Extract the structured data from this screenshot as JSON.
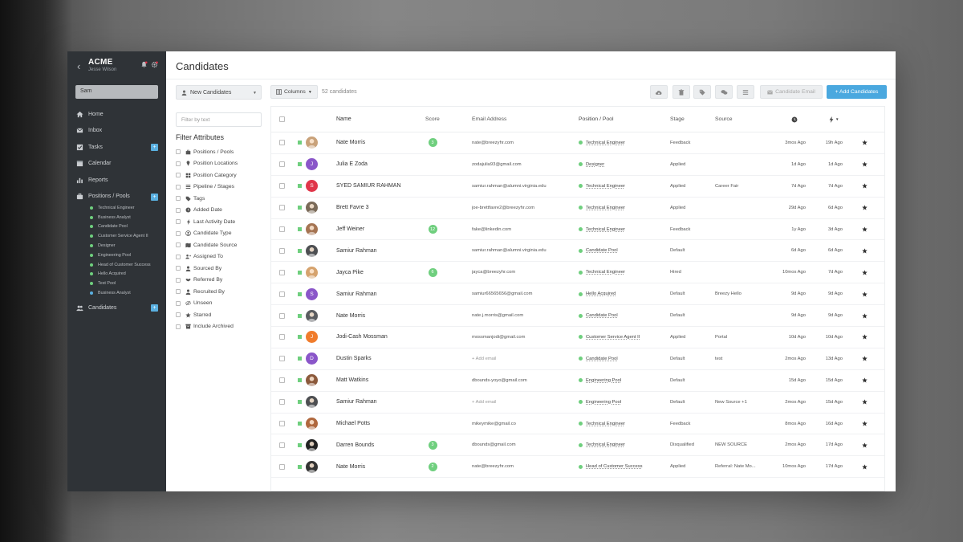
{
  "brand": {
    "name": "ACME",
    "user": "Jesse Wilson"
  },
  "sidebar": {
    "search_value": "Sam",
    "nav": [
      {
        "label": "Home",
        "icon": "home-icon"
      },
      {
        "label": "Inbox",
        "icon": "inbox-icon"
      },
      {
        "label": "Tasks",
        "icon": "tasks-icon",
        "plus": "+"
      },
      {
        "label": "Calendar",
        "icon": "calendar-icon"
      },
      {
        "label": "Reports",
        "icon": "reports-icon"
      },
      {
        "label": "Positions / Pools",
        "icon": "briefcase-icon",
        "plus": "+"
      }
    ],
    "pools": [
      "Technical Engineer",
      "Business Analyst",
      "Candidate Pool",
      "Customer Service Agent II",
      "Designer",
      "Engineering Pool",
      "Head of Customer Success",
      "Hello Acquired",
      "Test Pool",
      "Business Analyst"
    ],
    "candidates": {
      "label": "Candidates",
      "icon": "users-icon",
      "plus": "+"
    }
  },
  "main": {
    "title": "Candidates",
    "pipeline_dropdown": "New Candidates",
    "filter_placeholder": "Filter by text",
    "filter_title": "Filter Attributes",
    "attributes": [
      {
        "label": "Positions / Pools",
        "icon": "briefcase-icon"
      },
      {
        "label": "Position Locations",
        "icon": "pin-icon"
      },
      {
        "label": "Position Category",
        "icon": "grid-icon"
      },
      {
        "label": "Pipeline / Stages",
        "icon": "list-icon"
      },
      {
        "label": "Tags",
        "icon": "tag-icon"
      },
      {
        "label": "Added Date",
        "icon": "clock-icon"
      },
      {
        "label": "Last Activity Date",
        "icon": "bolt-icon"
      },
      {
        "label": "Candidate Type",
        "icon": "user-circle-icon"
      },
      {
        "label": "Candidate Source",
        "icon": "map-icon"
      },
      {
        "label": "Assigned To",
        "icon": "user-plus-icon"
      },
      {
        "label": "Sourced By",
        "icon": "user-icon"
      },
      {
        "label": "Referred By",
        "icon": "handshake-icon"
      },
      {
        "label": "Recruited By",
        "icon": "user-icon"
      },
      {
        "label": "Unseen",
        "icon": "eye-slash-icon"
      },
      {
        "label": "Starred",
        "icon": "star-icon"
      },
      {
        "label": "Include Archived",
        "icon": "archive-icon"
      }
    ],
    "columns_button": "Columns",
    "count": "52 candidates",
    "email_button": "Candidate Email",
    "add_button": "+ Add Candidates",
    "headers": {
      "name": "Name",
      "score": "Score",
      "email": "Email Address",
      "position": "Position / Pool",
      "stage": "Stage",
      "source": "Source"
    },
    "rows": [
      {
        "name": "Nate Morris",
        "score": "3",
        "email": "nate@breezyhr.com",
        "position": "Technical Engineer",
        "stage": "Feedback",
        "source": "",
        "added": "3mos Ago",
        "activity": "19h Ago",
        "avatar": "photo",
        "avatar_color": "#c9a27a"
      },
      {
        "name": "Julia E Zoda",
        "score": "",
        "email": "zodajulia93@gmail.com",
        "position": "Designer",
        "stage": "Applied",
        "source": "",
        "added": "1d Ago",
        "activity": "1d Ago",
        "avatar": "J",
        "avatar_color": "#8a56c9"
      },
      {
        "name": "SYED SAMIUR RAHMAN",
        "score": "",
        "email": "samiur.rahman@alumni.virginia.edu",
        "position": "Technical Engineer",
        "stage": "Applied",
        "source": "Career Fair",
        "added": "7d Ago",
        "activity": "7d Ago",
        "avatar": "S",
        "avatar_color": "#e0364a"
      },
      {
        "name": "Brett Favre 3",
        "score": "",
        "email": "joe-brettfavre2@breezyhr.com",
        "position": "Technical Engineer",
        "stage": "Applied",
        "source": "",
        "added": "29d Ago",
        "activity": "6d Ago",
        "avatar": "photo",
        "avatar_color": "#7a6a58"
      },
      {
        "name": "Jeff Weiner",
        "score": "12",
        "email": "fake@linkedin.com",
        "position": "Technical Engineer",
        "stage": "Feedback",
        "source": "",
        "added": "1y Ago",
        "activity": "3d Ago",
        "avatar": "photo",
        "avatar_color": "#a57452"
      },
      {
        "name": "Samiur Rahman",
        "score": "",
        "email": "samiur.rahman@alumni.virginia.edu",
        "position": "Candidate Pool",
        "stage": "Default",
        "source": "",
        "added": "6d Ago",
        "activity": "6d Ago",
        "avatar": "photo",
        "avatar_color": "#4d4f52"
      },
      {
        "name": "Jayca Pike",
        "score": "6",
        "email": "jayca@breezyhr.com",
        "position": "Technical Engineer",
        "stage": "Hired",
        "source": "",
        "added": "10mos Ago",
        "activity": "7d Ago",
        "avatar": "photo",
        "avatar_color": "#d6a36e"
      },
      {
        "name": "Samiur Rahman",
        "score": "",
        "email": "samiur66565656@gmail.com",
        "position": "Hello Acquired",
        "stage": "Default",
        "source": "Breezy Hello",
        "added": "9d Ago",
        "activity": "9d Ago",
        "avatar": "S",
        "avatar_color": "#8a56c9"
      },
      {
        "name": "Nate Morris",
        "score": "",
        "email": "nate.j.morris@gmail.com",
        "position": "Candidate Pool",
        "stage": "Default",
        "source": "",
        "added": "9d Ago",
        "activity": "9d Ago",
        "avatar": "photo",
        "avatar_color": "#5a5c60"
      },
      {
        "name": "Jodi-Cash Mossman",
        "score": "",
        "email": "mossmanjodi@gmail.com",
        "position": "Customer Service Agent II",
        "stage": "Applied",
        "source": "Portal",
        "added": "10d Ago",
        "activity": "10d Ago",
        "avatar": "J",
        "avatar_color": "#f07c2c"
      },
      {
        "name": "Dustin Sparks",
        "score": "",
        "email": "+ Add email",
        "position": "Candidate Pool",
        "stage": "Default",
        "source": "test",
        "added": "2mos Ago",
        "activity": "13d Ago",
        "avatar": "D",
        "avatar_color": "#8a56c9"
      },
      {
        "name": "Matt Watkins",
        "score": "",
        "email": "dbounds-yoyo@gmail.com",
        "position": "Engineering Pool",
        "stage": "Default",
        "source": "",
        "added": "15d Ago",
        "activity": "15d Ago",
        "avatar": "photo",
        "avatar_color": "#8c5a3c"
      },
      {
        "name": "Samiur Rahman",
        "score": "",
        "email": "+ Add email",
        "position": "Engineering Pool",
        "stage": "Default",
        "source": "New Source +1",
        "added": "2mos Ago",
        "activity": "15d Ago",
        "avatar": "photo",
        "avatar_color": "#4d4f52"
      },
      {
        "name": "Michael Potts",
        "score": "",
        "email": "mikeymike@gmail.co",
        "position": "Technical Engineer",
        "stage": "Feedback",
        "source": "",
        "added": "8mos Ago",
        "activity": "16d Ago",
        "avatar": "photo",
        "avatar_color": "#b0683e"
      },
      {
        "name": "Darren Bounds",
        "score": "3",
        "email": "dbounds@gmail.com",
        "position": "Technical Engineer",
        "stage": "Disqualified",
        "source": "NEW SOURCE",
        "added": "2mos Ago",
        "activity": "17d Ago",
        "avatar": "photo",
        "avatar_color": "#222222"
      },
      {
        "name": "Nate Morris",
        "score": "2",
        "email": "nate@breezyhr.com",
        "position": "Head of Customer Success",
        "stage": "Applied",
        "source": "Referral: Nate Mo...",
        "added": "10mos Ago",
        "activity": "17d Ago",
        "avatar": "photo",
        "avatar_color": "#333333"
      }
    ]
  },
  "chat": {
    "badge": "1"
  },
  "colors": {
    "sidebar": "#2f3337",
    "accent": "#4aa8df",
    "status_green": "#6fcf7e"
  }
}
